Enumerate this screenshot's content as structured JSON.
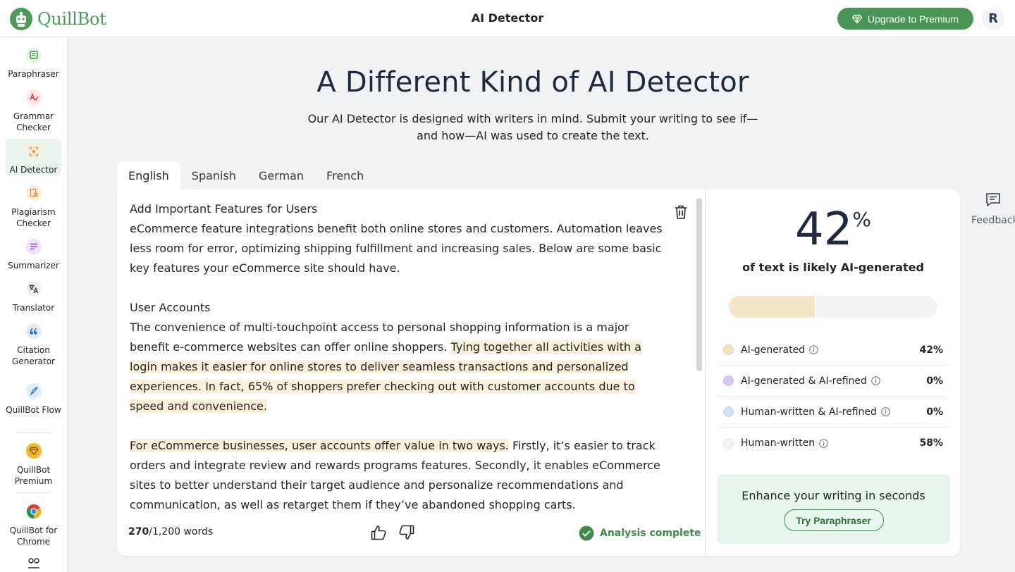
{
  "header": {
    "brand": "QuillBot",
    "title": "AI Detector",
    "upgrade_label": "Upgrade to Premium",
    "avatar_initial": "R"
  },
  "sidebar": {
    "items": [
      {
        "label": "Paraphraser",
        "icon": "paraphraser-icon"
      },
      {
        "label": "Grammar Checker",
        "icon": "grammar-checker-icon"
      },
      {
        "label": "AI Detector",
        "icon": "ai-detector-icon",
        "active": true
      },
      {
        "label": "Plagiarism Checker",
        "icon": "plagiarism-checker-icon"
      },
      {
        "label": "Summarizer",
        "icon": "summarizer-icon"
      },
      {
        "label": "Translator",
        "icon": "translator-icon"
      },
      {
        "label": "Citation Generator",
        "icon": "citation-generator-icon"
      },
      {
        "label": "QuillBot Flow",
        "icon": "quillbot-flow-icon"
      },
      {
        "label": "QuillBot Premium",
        "icon": "premium-diamond-icon"
      },
      {
        "label": "QuillBot for Chrome",
        "icon": "chrome-icon"
      }
    ]
  },
  "hero": {
    "title": "A Different Kind of AI Detector",
    "subtitle": "Our AI Detector is designed with writers in mind. Submit your writing to see if—and how—AI was used to create the text."
  },
  "tabs": [
    "English",
    "Spanish",
    "German",
    "French"
  ],
  "editor": {
    "heading1": "Add Important Features for Users",
    "para1": "eCommerce feature integrations benefit both online stores and customers. Automation leaves less room for error, optimizing shipping fulfillment and increasing sales. Below are some basic key features your eCommerce site should have.",
    "heading2": "User Accounts",
    "para2_plain": "The convenience of multi-touchpoint access to personal shopping information is a major benefit e-commerce websites can offer online shoppers. ",
    "para2_hl": "Tying together all activities with a login makes it easier for online stores to deliver seamless transactions and personalized experiences. In fact, 65% of shoppers prefer checking out with customer accounts due to speed and convenience.",
    "para3_hl": "For eCommerce businesses, user accounts offer value in two ways.",
    "para3_plain": " Firstly, it’s easier to track orders and integrate review and rewards programs features. Secondly, it enables eCommerce sites to better understand their target audience and personalize recommendations and communication, as well as retarget them if they’ve abandoned shopping carts.",
    "word_count": "270",
    "word_limit": "/1,200 words",
    "status": "Analysis complete"
  },
  "results": {
    "percent": "42",
    "percent_symbol": "%",
    "caption": "of text is likely AI-generated",
    "ai_fraction": 0.42,
    "legend": [
      {
        "label": "AI-generated",
        "value": "42%",
        "color": "#f5e3c3"
      },
      {
        "label": "AI-generated & AI-refined",
        "value": "0%",
        "color": "#dcc6f2"
      },
      {
        "label": "Human-written & AI-refined",
        "value": "0%",
        "color": "#cfe0f7"
      },
      {
        "label": "Human-written",
        "value": "58%",
        "color": "#f2f3f4"
      }
    ],
    "promo_title": "Enhance your writing in seconds",
    "promo_button": "Try Paraphraser"
  },
  "feedback": {
    "label": "Feedback"
  },
  "colors": {
    "brand_green": "#499557",
    "highlight": "#fbf0d9"
  }
}
